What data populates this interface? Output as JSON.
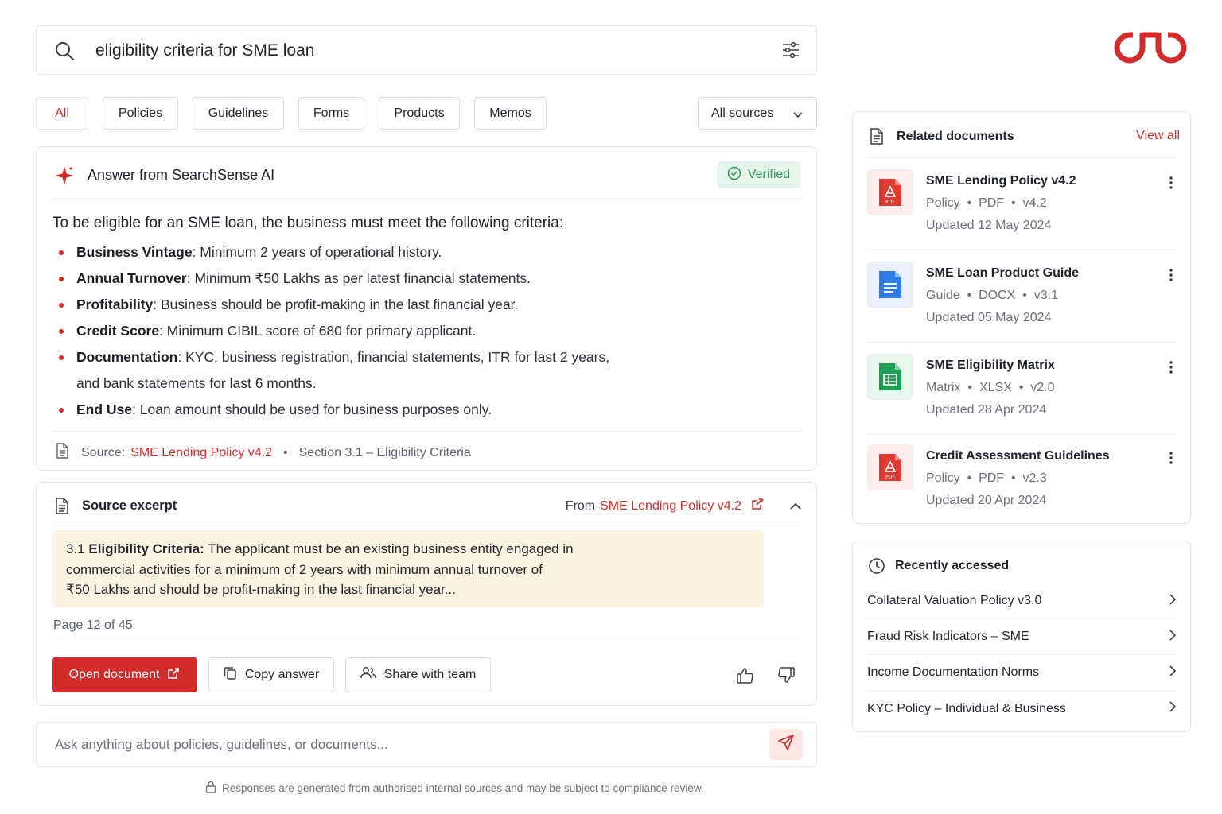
{
  "search": {
    "query": "eligibility criteria for SME loan"
  },
  "filters": {
    "tabs": [
      "All",
      "Policies",
      "Guidelines",
      "Forms",
      "Products",
      "Memos"
    ],
    "sources_select": "All sources"
  },
  "answer": {
    "header": "Answer from SearchSense AI",
    "verified": "Verified",
    "intro": "To be eligible for an SME loan, the business must meet the following criteria:",
    "criteria": [
      {
        "term": "Business Vintage",
        "text": ": Minimum 2 years of operational history."
      },
      {
        "term": "Annual Turnover",
        "text": ": Minimum ₹50 Lakhs as per latest financial statements."
      },
      {
        "term": "Profitability",
        "text": ": Business should be profit-making in the last financial year."
      },
      {
        "term": "Credit Score",
        "text": ": Minimum CIBIL score of 680 for primary applicant."
      },
      {
        "term": "Documentation",
        "text": ": KYC, business registration, financial statements, ITR for last 2 years,",
        "text2": "and bank statements for last 6 months."
      },
      {
        "term": "End Use",
        "text": ": Loan amount should be used for business purposes only."
      }
    ],
    "source_label": "Source:",
    "source_doc": "SME Lending Policy v4.2",
    "source_section": "Section 3.1 – Eligibility Criteria"
  },
  "excerpt": {
    "title": "Source excerpt",
    "from_label": "From",
    "from_doc": "SME Lending Policy v4.2",
    "lead": "3.1 ",
    "heading": "Eligibility Criteria:",
    "line1": " The applicant must be an existing business entity engaged in",
    "line2": "commercial activities for a minimum of 2 years with minimum annual turnover of",
    "line3": "₹50 Lakhs and should be profit-making in the last financial year...",
    "page": "Page 12 of 45",
    "open_button": "Open document",
    "copy_button": "Copy answer",
    "share_button": "Share with team"
  },
  "ask": {
    "placeholder": "Ask anything about policies, guidelines, or documents..."
  },
  "footnote": "Responses are generated from authorised internal sources and may be subject to compliance review.",
  "related": {
    "title": "Related documents",
    "view_all": "View all",
    "docs": [
      {
        "name": "SME Lending Policy v4.2",
        "type": "Policy",
        "format": "PDF",
        "version": "v4.2",
        "updated": "Updated 12 May 2024",
        "icon": "pdf-icon"
      },
      {
        "name": "SME Loan Product Guide",
        "type": "Guide",
        "format": "DOCX",
        "version": "v3.1",
        "updated": "Updated 05 May 2024",
        "icon": "doc-icon"
      },
      {
        "name": "SME Eligibility Matrix",
        "type": "Matrix",
        "format": "XLSX",
        "version": "v2.0",
        "updated": "Updated 28 Apr 2024",
        "icon": "sheet-icon"
      },
      {
        "name": "Credit Assessment Guidelines",
        "type": "Policy",
        "format": "PDF",
        "version": "v2.3",
        "updated": "Updated 20 Apr 2024",
        "icon": "pdf-icon"
      }
    ]
  },
  "recent": {
    "title": "Recently accessed",
    "items": [
      "Collateral Valuation Policy v3.0",
      "Fraud Risk Indicators – SME",
      "Income Documentation Norms",
      "KYC Policy – Individual & Business"
    ]
  },
  "colors": {
    "accent": "#d32a2a",
    "verified_bg": "#e6f5ec",
    "verified_text": "#2f9c5a",
    "excerpt_bg": "#fdf3e3"
  }
}
